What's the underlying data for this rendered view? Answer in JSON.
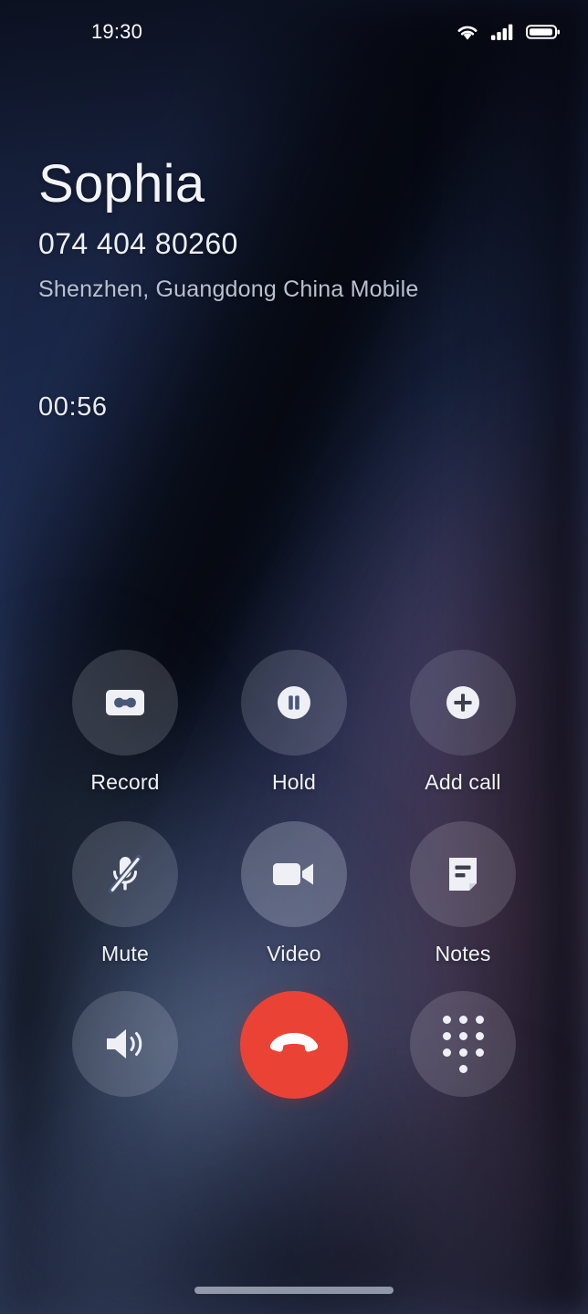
{
  "status_bar": {
    "clock": "19:30",
    "icons": [
      "wifi-icon",
      "cellular-signal-icon",
      "battery-icon"
    ]
  },
  "call": {
    "contact_name": "Sophia",
    "phone_number": "074 404 80260",
    "carrier_location": "Shenzhen, Guangdong China Mobile",
    "duration": "00:56"
  },
  "controls": {
    "rows": [
      [
        {
          "label": "Record",
          "icon": "cassette-tape-icon"
        },
        {
          "label": "Hold",
          "icon": "pause-circle-icon"
        },
        {
          "label": "Add call",
          "icon": "plus-circle-icon"
        }
      ],
      [
        {
          "label": "Mute",
          "icon": "microphone-muted-icon"
        },
        {
          "label": "Video",
          "icon": "video-camera-icon"
        },
        {
          "label": "Notes",
          "icon": "note-page-icon"
        }
      ],
      [
        {
          "label": "",
          "icon": "speaker-icon"
        },
        {
          "label": "",
          "icon": "end-call-handset-icon"
        },
        {
          "label": "",
          "icon": "dialpad-icon"
        }
      ]
    ]
  },
  "colors": {
    "end_call_red": "#EA4335",
    "icon_white": "#EEF0F6",
    "label_white": "#F0F2F7",
    "carrier_gray": "#B9C0CF",
    "background_navy": "#1D2B4F"
  },
  "home_indicator": "gesture-home-bar"
}
